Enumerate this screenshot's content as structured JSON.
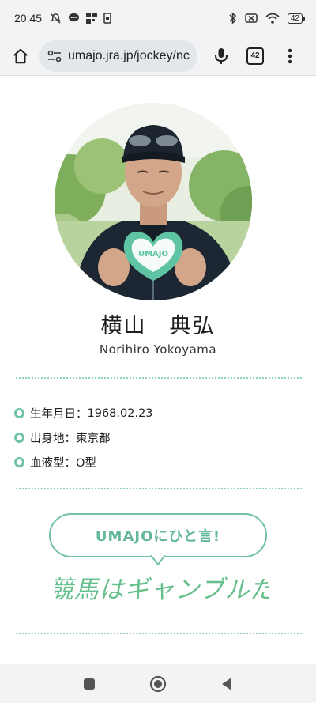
{
  "status_bar": {
    "time": "20:45",
    "battery": "42"
  },
  "browser": {
    "url": "umajo.jra.jp/jockey/nc",
    "tab_count": "42"
  },
  "profile": {
    "name_ja": "横山　典弘",
    "name_en": "Norihiro Yokoyama",
    "photo_card_text": "UMAJO",
    "info": [
      {
        "label": "生年月日：",
        "value": "1968.02.23"
      },
      {
        "label": "出身地：",
        "value": "東京都"
      },
      {
        "label": "血液型：",
        "value": "O型"
      }
    ]
  },
  "comment": {
    "heading": "UMAJOにひと言!",
    "text": "競馬はギャンブルだ"
  },
  "colors": {
    "accent": "#6fc2a6",
    "divider": "#8fd1be",
    "handwriting": "#66c08c"
  }
}
